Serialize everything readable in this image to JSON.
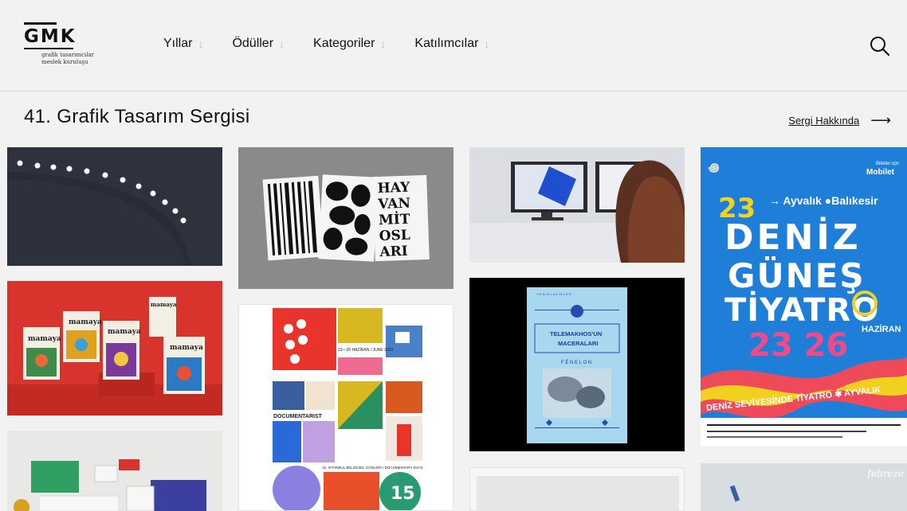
{
  "logo": {
    "mark": "GMK",
    "sub_line1": "grafik tasarımcılar",
    "sub_line2": "meslek kuruluşu"
  },
  "nav": [
    {
      "label": "Yıllar"
    },
    {
      "label": "Ödüller"
    },
    {
      "label": "Kategoriler"
    },
    {
      "label": "Katılımcılar"
    }
  ],
  "icons": {
    "search": "search-icon",
    "nav_arrow": "arrow-down-icon",
    "about_arrow": "arrow-right-icon"
  },
  "page": {
    "title": "41. Grafik Tasarım Sergisi",
    "about_link": "Sergi Hakkında"
  },
  "cards": {
    "poster_hayvan": {
      "text_lines": [
        "HAY",
        "VAN",
        "MİT",
        "OSL",
        "ARI"
      ]
    },
    "mamaya": {
      "brand": "mamaya"
    },
    "documentarist": {
      "dates": "23—30 HAZİRAN / JUNE 2022",
      "name": "DOCUMENTARIST",
      "subtitle": "15. İSTANBUL BELGESEL GÜNLERİ / DOCUMENTARY DAYS",
      "badge": "15"
    },
    "telemakhos": {
      "top": "Y E N İ   K L A S İ K L E R",
      "title_line1": "TELEMAKHOS'UN",
      "title_line2": "MACERALARI",
      "author": "F É N E L O N"
    },
    "tiyatro": {
      "sponsor_note": "Biletler için",
      "sponsor": "Mobilet",
      "route": "→ Ayvalık ●Balıkesir",
      "number_top": "23",
      "line1": "DENİZ",
      "line2": "GÜNEŞ",
      "line3": "TİYATRO",
      "days": "23 26",
      "month": "HAZİRAN",
      "ribbon": "DENİZ SEVİYESİNDE TİYATRO ✱ AYVALIK"
    },
    "bottom_right": {
      "brand": "febreze"
    }
  },
  "colors": {
    "accent_blue": "#1f7fd8",
    "mamaya_red": "#d8332c",
    "poster_grey": "#8a8a8a"
  }
}
